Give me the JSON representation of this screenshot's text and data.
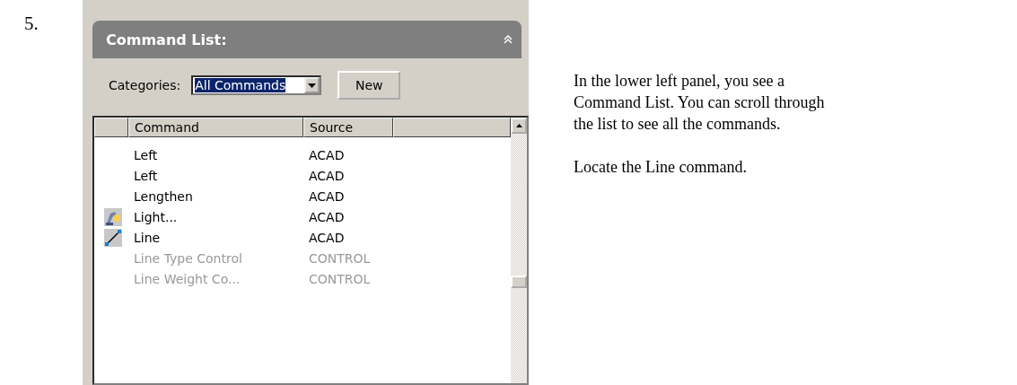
{
  "step_number": "5.",
  "panel": {
    "title": "Command List:",
    "categories_label": "Categories:",
    "categories_value": "All Commands",
    "new_button": "New",
    "columns": [
      "Command",
      "Source"
    ],
    "rows": [
      {
        "kind": "plain",
        "command": "Left",
        "source": "ACAD",
        "disabled": false
      },
      {
        "kind": "plain",
        "command": "Left",
        "source": "ACAD",
        "disabled": false
      },
      {
        "kind": "plain",
        "command": "Lengthen",
        "source": "ACAD",
        "disabled": false
      },
      {
        "kind": "lamp",
        "command": "Light...",
        "source": "ACAD",
        "disabled": false
      },
      {
        "kind": "line",
        "command": "Line",
        "source": "ACAD",
        "disabled": false
      },
      {
        "kind": "plain",
        "command": "Line Type Control",
        "source": "CONTROL",
        "disabled": true
      },
      {
        "kind": "plain",
        "command": "Line Weight Co...",
        "source": "CONTROL",
        "disabled": true
      }
    ]
  },
  "paragraphs": [
    "In the lower left panel, you see a Command List.  You can scroll through the list to see all the commands.",
    "Locate the Line command."
  ]
}
